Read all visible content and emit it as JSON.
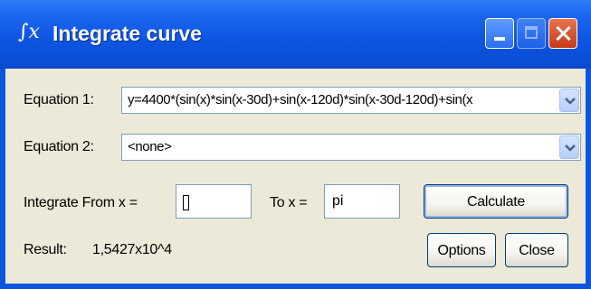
{
  "window": {
    "title": "Integrate curve",
    "icon": "integral-icon",
    "title_icon_text": "∫x"
  },
  "form": {
    "equation1_label": "Equation 1:",
    "equation1_value": "y=4400*(sin(x)*sin(x-30d)+sin(x-120d)*sin(x-30d-120d)+sin(x",
    "equation2_label": "Equation 2:",
    "equation2_value": "<none>",
    "from_label": "Integrate From x =",
    "from_value": "",
    "to_label": "To x =",
    "to_value": "pi",
    "result_label": "Result:",
    "result_value": "1,5427x10^4"
  },
  "buttons": {
    "calculate": "Calculate",
    "options": "Options",
    "close": "Close"
  },
  "colors": {
    "titlebar": "#0a56e0",
    "client": "#ece9d8",
    "close_button": "#d8491f"
  }
}
